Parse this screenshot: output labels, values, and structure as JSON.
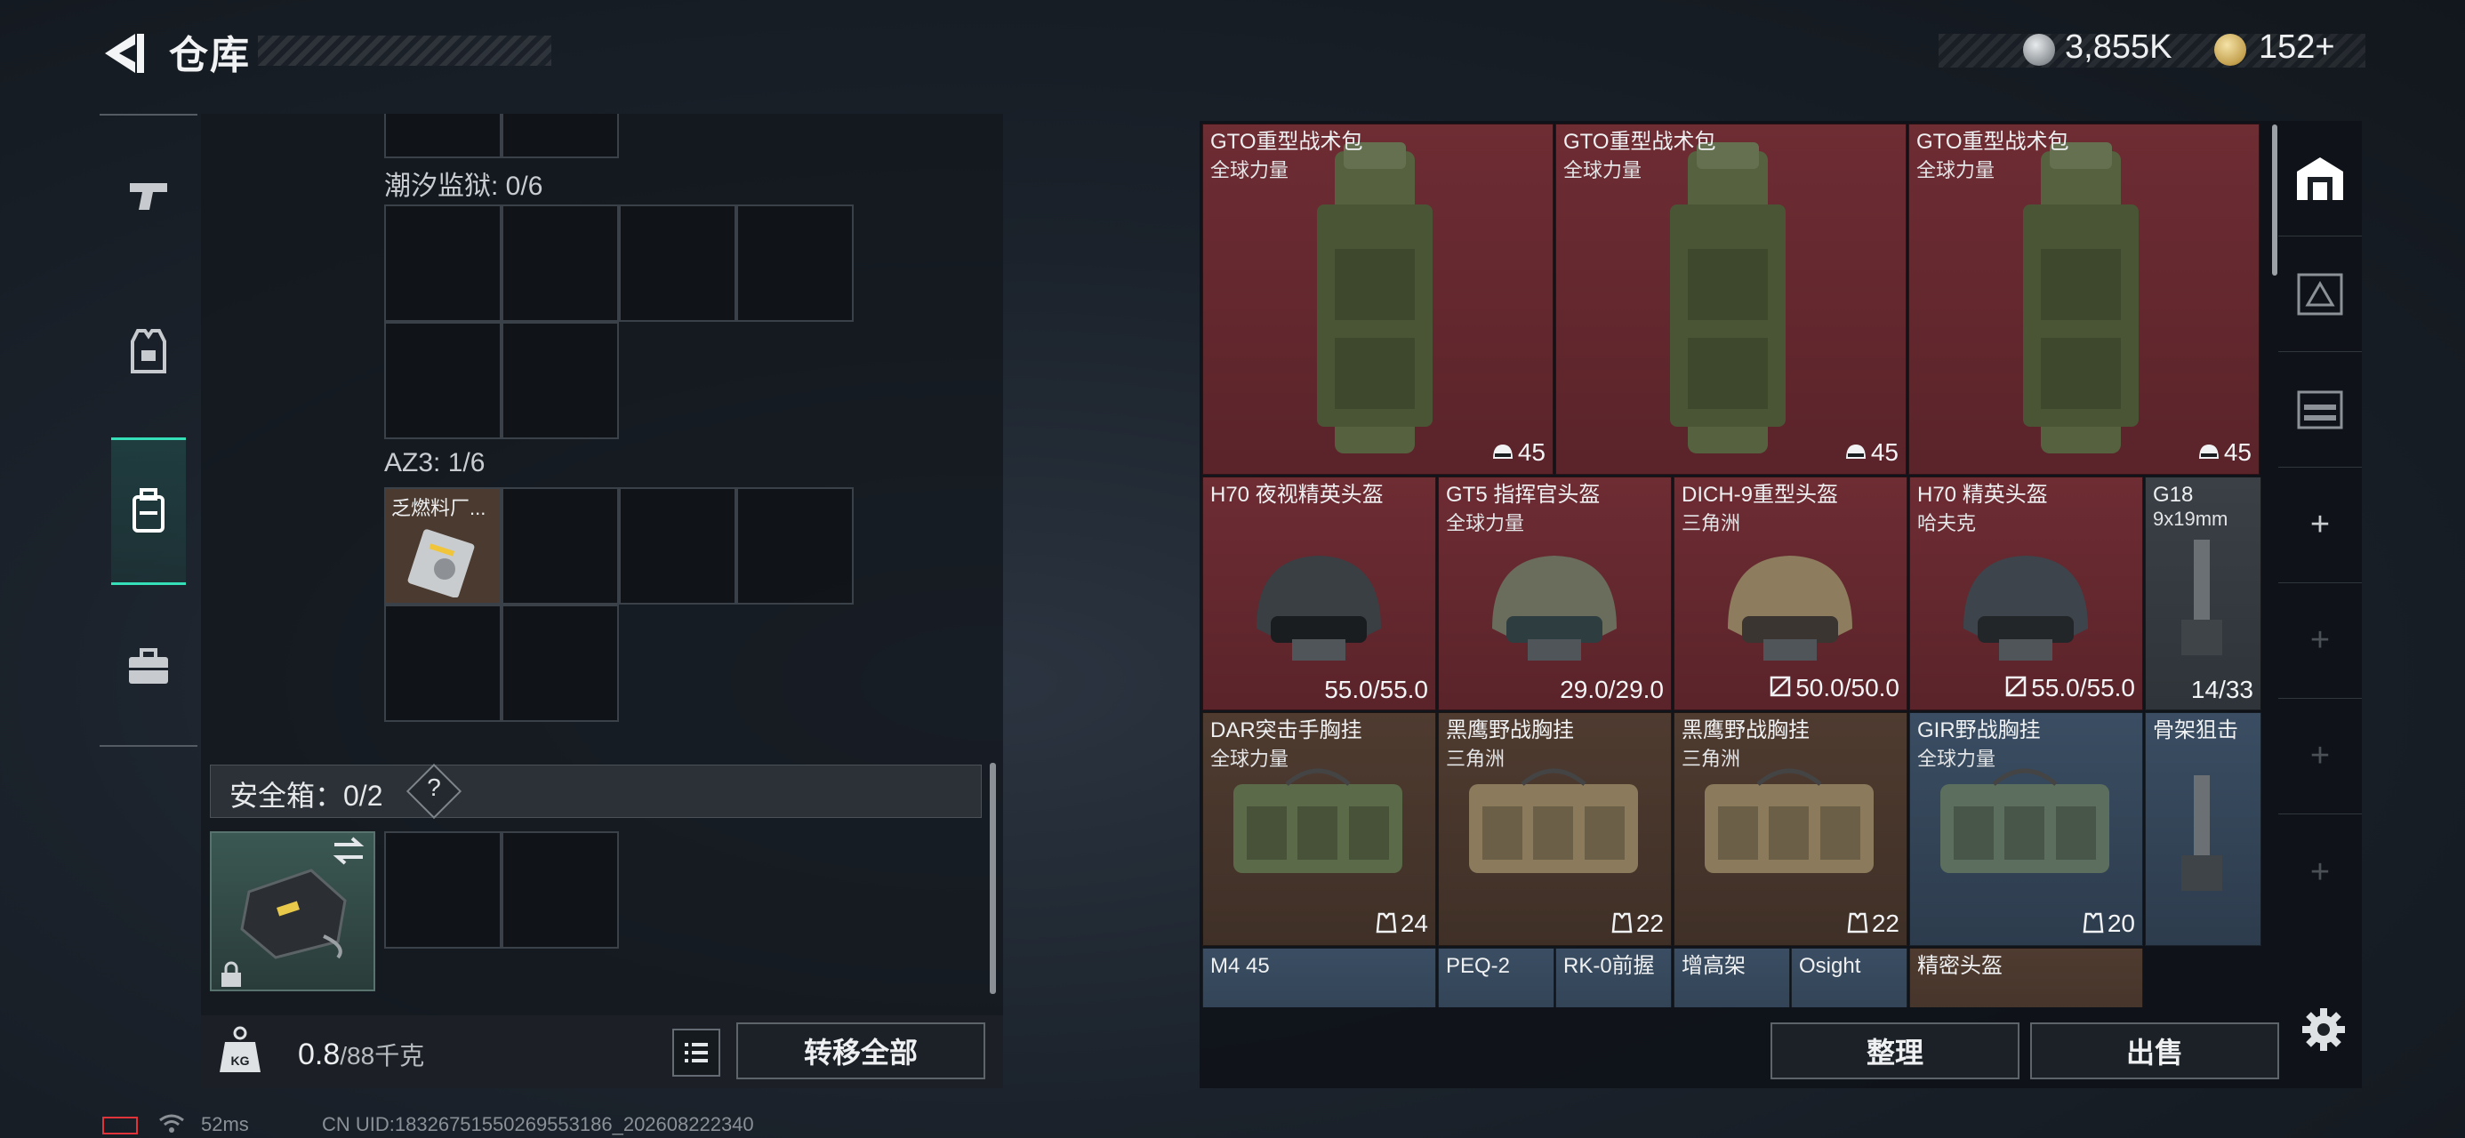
{
  "header": {
    "title": "仓库",
    "silver_amount": "3,855K",
    "gold_amount": "152",
    "gold_plus": "+"
  },
  "left_rail": {
    "items": [
      {
        "name": "weapons",
        "icon": "pistol-icon"
      },
      {
        "name": "armor",
        "icon": "vest-icon"
      },
      {
        "name": "backpack",
        "icon": "backpack-icon",
        "active": true
      },
      {
        "name": "case",
        "icon": "briefcase-icon"
      }
    ]
  },
  "containers": {
    "tide_prison": "潮汐监狱: 0/6",
    "az3": "AZ3: 1/6",
    "az3_item_label": "乏燃料厂...",
    "safe_box": "安全箱：0/2",
    "safe_box_help": "?"
  },
  "weight": {
    "current": "0.8",
    "max": "/88千克"
  },
  "buttons": {
    "transfer_all": "转移全部",
    "sort": "整理",
    "sell": "出售"
  },
  "items": [
    {
      "name": "GTO重型战术包",
      "sub": "全球力量",
      "value": "45",
      "value_icon": "helmet-icon",
      "color": "red"
    },
    {
      "name": "GTO重型战术包",
      "sub": "全球力量",
      "value": "45",
      "value_icon": "helmet-icon",
      "color": "red"
    },
    {
      "name": "GTO重型战术包",
      "sub": "全球力量",
      "value": "45",
      "value_icon": "helmet-icon",
      "color": "red"
    },
    {
      "name": "H70 夜视精英头盔",
      "sub": "",
      "value": "55.0/55.0",
      "color": "red"
    },
    {
      "name": "GT5 指挥官头盔",
      "sub": "全球力量",
      "value": "29.0/29.0",
      "color": "red"
    },
    {
      "name": "DICH-9重型头盔",
      "sub": "三角洲",
      "value": "50.0/50.0",
      "value_icon": "no-repair-icon",
      "color": "red"
    },
    {
      "name": "H70 精英头盔",
      "sub": "哈夫克",
      "value": "55.0/55.0",
      "value_icon": "no-repair-icon",
      "color": "red"
    },
    {
      "name": "G18",
      "sub": "9x19mm",
      "value": "14/33",
      "color": "grey"
    },
    {
      "name": "DAR突击手胸挂",
      "sub": "全球力量",
      "value": "24",
      "value_icon": "vest-slot-icon",
      "color": "brown"
    },
    {
      "name": "黑鹰野战胸挂",
      "sub": "三角洲",
      "value": "22",
      "value_icon": "vest-slot-icon",
      "color": "brown"
    },
    {
      "name": "黑鹰野战胸挂",
      "sub": "三角洲",
      "value": "22",
      "value_icon": "vest-slot-icon",
      "color": "brown"
    },
    {
      "name": "GIR野战胸挂",
      "sub": "全球力量",
      "value": "20",
      "value_icon": "vest-slot-icon",
      "color": "blue"
    },
    {
      "name": "骨架狙击",
      "sub": "",
      "value": "",
      "color": "blue"
    },
    {
      "name": "M4 45",
      "sub": "",
      "value": "",
      "color": "blue"
    },
    {
      "name": "PEQ-2",
      "sub": "",
      "value": "",
      "color": "blue"
    },
    {
      "name": "RK-0前握",
      "sub": "",
      "value": "",
      "color": "blue"
    },
    {
      "name": "增高架",
      "sub": "",
      "value": "",
      "color": "blue"
    },
    {
      "name": "Osight",
      "sub": "",
      "value": "",
      "color": "blue"
    },
    {
      "name": "精密头盔",
      "sub": "",
      "value": "",
      "color": "brown"
    }
  ],
  "status": {
    "ping": "52ms",
    "uid": "CN UID:18326751550269553186_202608222340"
  },
  "colors": {
    "accent_teal": "#35e0b8",
    "item_red": "#6e2c33",
    "item_brown": "#4f3b30",
    "item_blue": "#3a4d62",
    "battery_red": "#e0343a"
  }
}
